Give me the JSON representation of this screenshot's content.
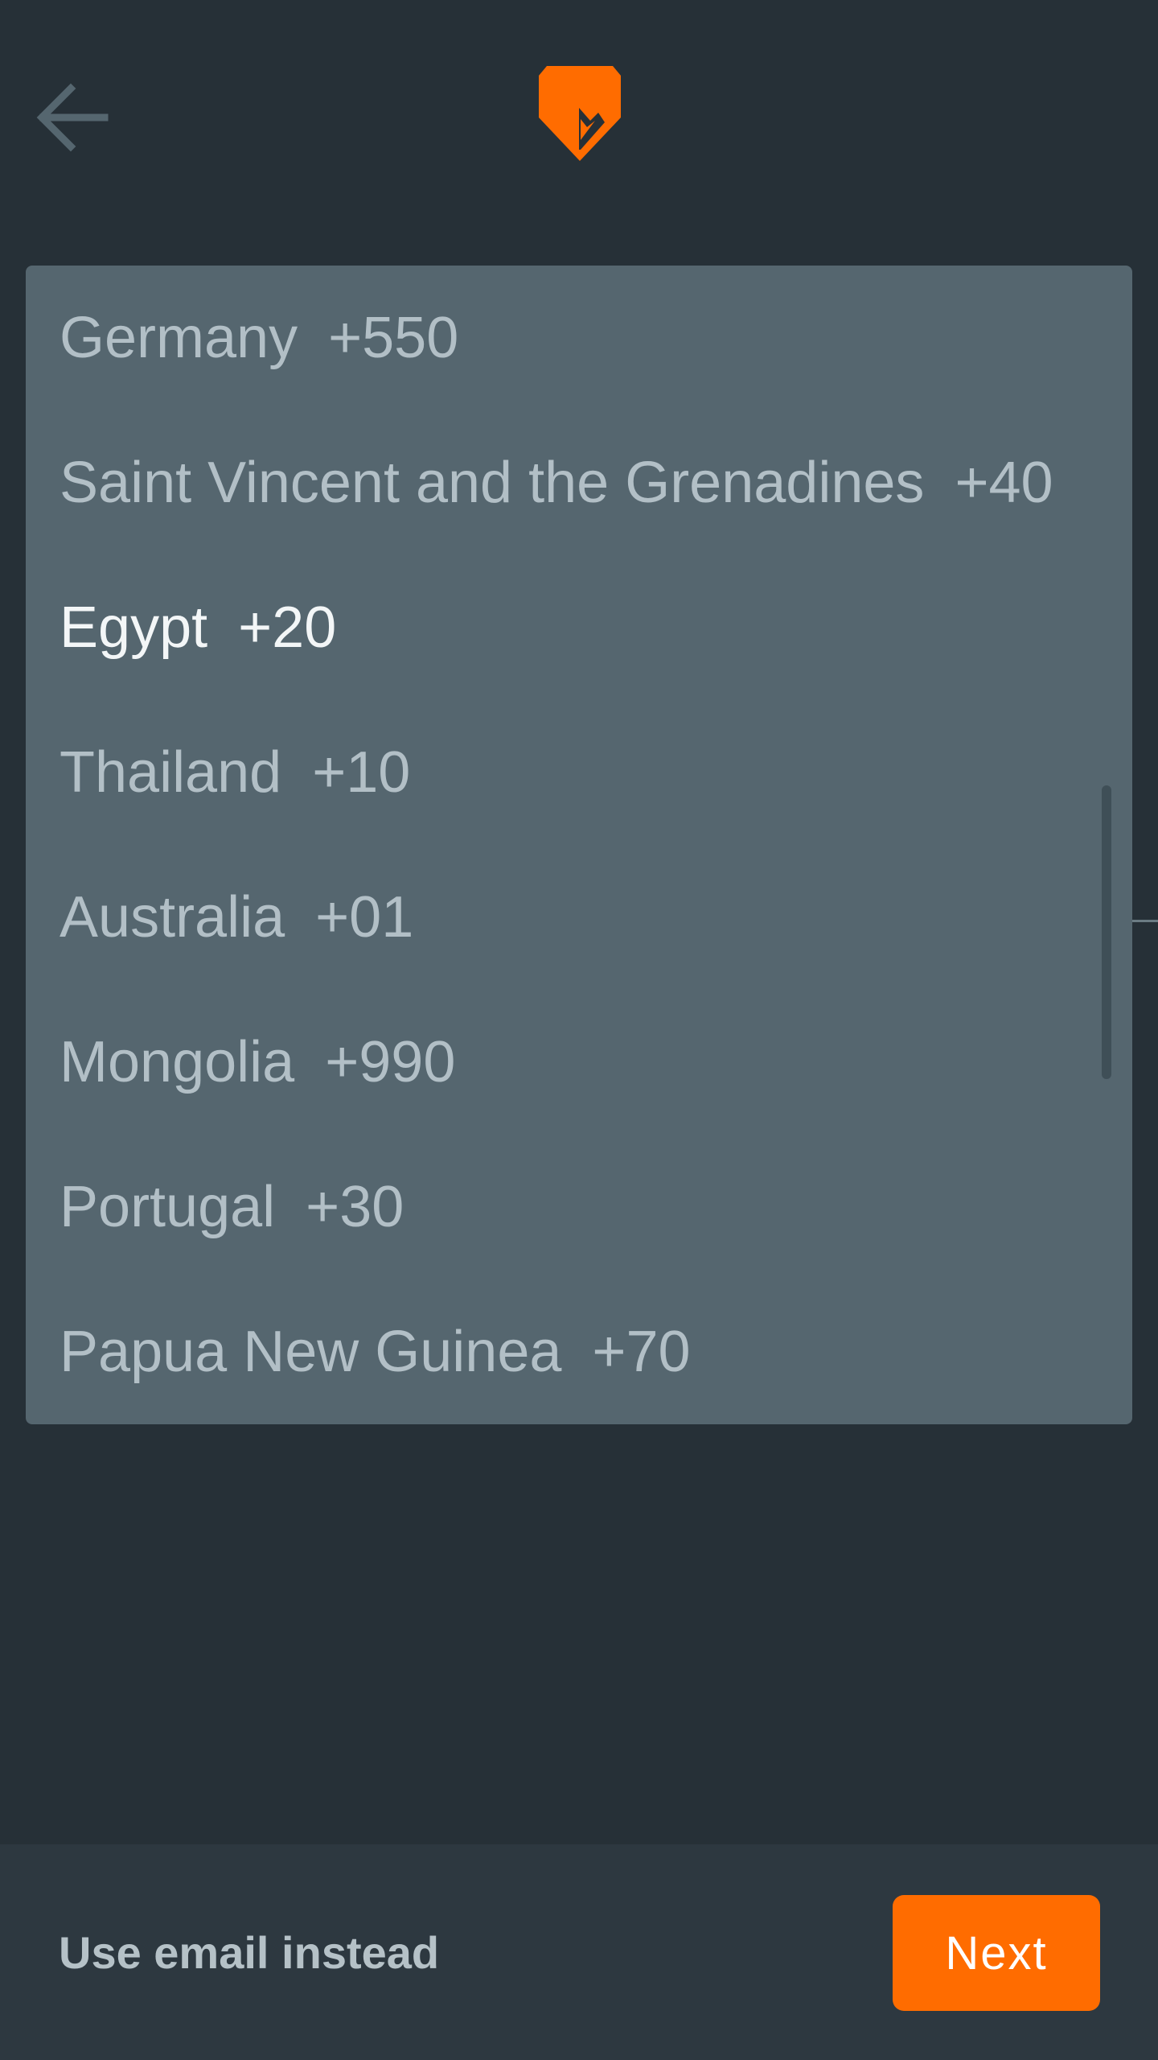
{
  "header": {
    "back_icon": "arrow-left-icon",
    "logo_icon": "orange-shield-logo-icon"
  },
  "country_list": {
    "items": [
      {
        "country": "Germany",
        "code": "+550"
      },
      {
        "country": "Saint Vincent and the Grenadines",
        "code": "+40"
      },
      {
        "country": "Egypt",
        "code": "+20"
      },
      {
        "country": "Thailand",
        "code": "+10"
      },
      {
        "country": "Australia",
        "code": "+01"
      },
      {
        "country": "Mongolia",
        "code": "+990"
      },
      {
        "country": "Portugal",
        "code": "+30"
      },
      {
        "country": "Papua New Guinea",
        "code": "+70"
      }
    ],
    "selected_index": 2
  },
  "footer": {
    "email_link_label": "Use email instead",
    "next_label": "Next"
  },
  "colors": {
    "background": "#263037",
    "dropdown": "#55666f",
    "accent": "#ff6c00",
    "text_muted": "#b2bfc6",
    "text_selected": "#f3f6f7"
  }
}
